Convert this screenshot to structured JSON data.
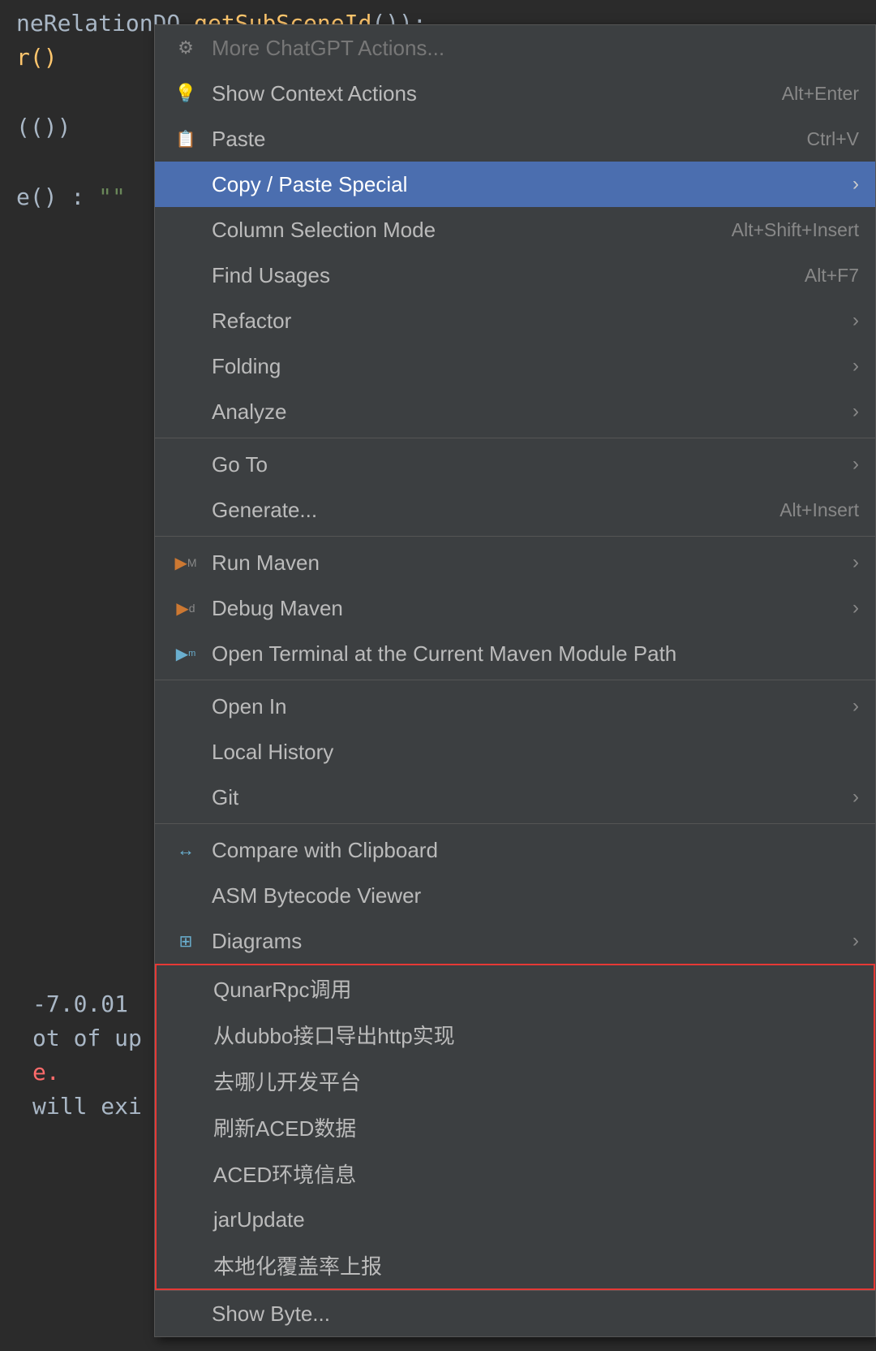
{
  "editor": {
    "lines": [
      {
        "text": "neRelationDO.getSubSceneId());",
        "color": "#a9b7c6"
      },
      {
        "text": "r()",
        "color": "#ffc66d"
      },
      {
        "text": "",
        "color": ""
      },
      {
        "text": "())  ",
        "color": "#a9b7c6"
      },
      {
        "text": "",
        "color": ""
      },
      {
        "text": "e() : \"\"",
        "color": "#a9b7c6"
      },
      {
        "text": "",
        "color": ""
      },
      {
        "text": "",
        "color": ""
      },
      {
        "text": "",
        "color": ""
      }
    ],
    "bottom_lines": [
      {
        "text": "-7.0.01",
        "color": "#a9b7c6"
      },
      {
        "text": "ot of up",
        "color": "#a9b7c6"
      },
      {
        "text": "e.",
        "color": "#ff6b6b"
      },
      {
        "text": "will exi",
        "color": "#a9b7c6"
      }
    ]
  },
  "context_menu": {
    "items": [
      {
        "id": "more-chatgpt",
        "icon": "⚙",
        "icon_type": "chatgpt",
        "label": "More ChatGPT Actions...",
        "shortcut": "",
        "has_submenu": false,
        "disabled": true,
        "separator_after": false
      },
      {
        "id": "show-context-actions",
        "icon": "💡",
        "icon_type": "bulb",
        "label": "Show Context Actions",
        "shortcut": "Alt+Enter",
        "has_submenu": false,
        "disabled": false,
        "separator_after": false
      },
      {
        "id": "paste",
        "icon": "📋",
        "icon_type": "paste",
        "label": "Paste",
        "shortcut": "Ctrl+V",
        "has_submenu": false,
        "disabled": false,
        "separator_after": false
      },
      {
        "id": "copy-paste-special",
        "icon": "",
        "icon_type": "",
        "label": "Copy / Paste Special",
        "shortcut": "",
        "has_submenu": true,
        "disabled": false,
        "highlighted": true,
        "separator_after": false
      },
      {
        "id": "column-selection-mode",
        "icon": "",
        "icon_type": "",
        "label": "Column Selection Mode",
        "shortcut": "Alt+Shift+Insert",
        "has_submenu": false,
        "disabled": false,
        "separator_after": false
      },
      {
        "id": "find-usages",
        "icon": "",
        "icon_type": "",
        "label": "Find Usages",
        "shortcut": "Alt+F7",
        "has_submenu": false,
        "disabled": false,
        "separator_after": false
      },
      {
        "id": "refactor",
        "icon": "",
        "icon_type": "",
        "label": "Refactor",
        "shortcut": "",
        "has_submenu": true,
        "disabled": false,
        "separator_after": false
      },
      {
        "id": "folding",
        "icon": "",
        "icon_type": "",
        "label": "Folding",
        "shortcut": "",
        "has_submenu": true,
        "disabled": false,
        "separator_after": false
      },
      {
        "id": "analyze",
        "icon": "",
        "icon_type": "",
        "label": "Analyze",
        "shortcut": "",
        "has_submenu": true,
        "disabled": false,
        "separator_after": false
      },
      {
        "id": "go-to",
        "icon": "",
        "icon_type": "",
        "label": "Go To",
        "shortcut": "",
        "has_submenu": true,
        "disabled": false,
        "separator_after": false
      },
      {
        "id": "generate",
        "icon": "",
        "icon_type": "",
        "label": "Generate...",
        "shortcut": "Alt+Insert",
        "has_submenu": false,
        "disabled": false,
        "separator_after": true
      },
      {
        "id": "run-maven",
        "icon": "▶",
        "icon_type": "maven-run",
        "label": "Run Maven",
        "shortcut": "",
        "has_submenu": true,
        "disabled": false,
        "separator_after": false
      },
      {
        "id": "debug-maven",
        "icon": "▶",
        "icon_type": "maven-debug",
        "label": "Debug Maven",
        "shortcut": "",
        "has_submenu": true,
        "disabled": false,
        "separator_after": false
      },
      {
        "id": "open-terminal",
        "icon": "▶",
        "icon_type": "terminal",
        "label": "Open Terminal at the Current Maven Module Path",
        "shortcut": "",
        "has_submenu": false,
        "disabled": false,
        "separator_after": true
      },
      {
        "id": "open-in",
        "icon": "",
        "icon_type": "",
        "label": "Open In",
        "shortcut": "",
        "has_submenu": true,
        "disabled": false,
        "separator_after": false
      },
      {
        "id": "local-history",
        "icon": "",
        "icon_type": "",
        "label": "Local History",
        "shortcut": "",
        "has_submenu": false,
        "disabled": false,
        "separator_after": false
      },
      {
        "id": "git",
        "icon": "",
        "icon_type": "",
        "label": "Git",
        "shortcut": "",
        "has_submenu": true,
        "disabled": false,
        "separator_after": true
      },
      {
        "id": "compare-clipboard",
        "icon": "↔",
        "icon_type": "compare",
        "label": "Compare with Clipboard",
        "shortcut": "",
        "has_submenu": false,
        "disabled": false,
        "separator_after": false
      },
      {
        "id": "asm-bytecode",
        "icon": "",
        "icon_type": "",
        "label": "ASM Bytecode Viewer",
        "shortcut": "",
        "has_submenu": false,
        "disabled": false,
        "separator_after": false
      },
      {
        "id": "diagrams",
        "icon": "⊞",
        "icon_type": "diagrams",
        "label": "Diagrams",
        "shortcut": "",
        "has_submenu": true,
        "disabled": false,
        "separator_after": false
      }
    ],
    "special_items": [
      {
        "id": "qunar-rpc",
        "label": "QunarRpc调用",
        "disabled": false
      },
      {
        "id": "dubbo-http",
        "label": "从dubbo接口导出http实现",
        "disabled": false
      },
      {
        "id": "qunar-dev",
        "label": "去哪儿开发平台",
        "disabled": false
      },
      {
        "id": "refresh-aced",
        "label": "刷新ACED数据",
        "disabled": false
      },
      {
        "id": "aced-env",
        "label": "ACED环境信息",
        "disabled": false
      },
      {
        "id": "jar-update",
        "label": "jarUpdate",
        "disabled": false
      },
      {
        "id": "localization",
        "label": "本地化覆盖率上报",
        "disabled": true
      }
    ]
  }
}
